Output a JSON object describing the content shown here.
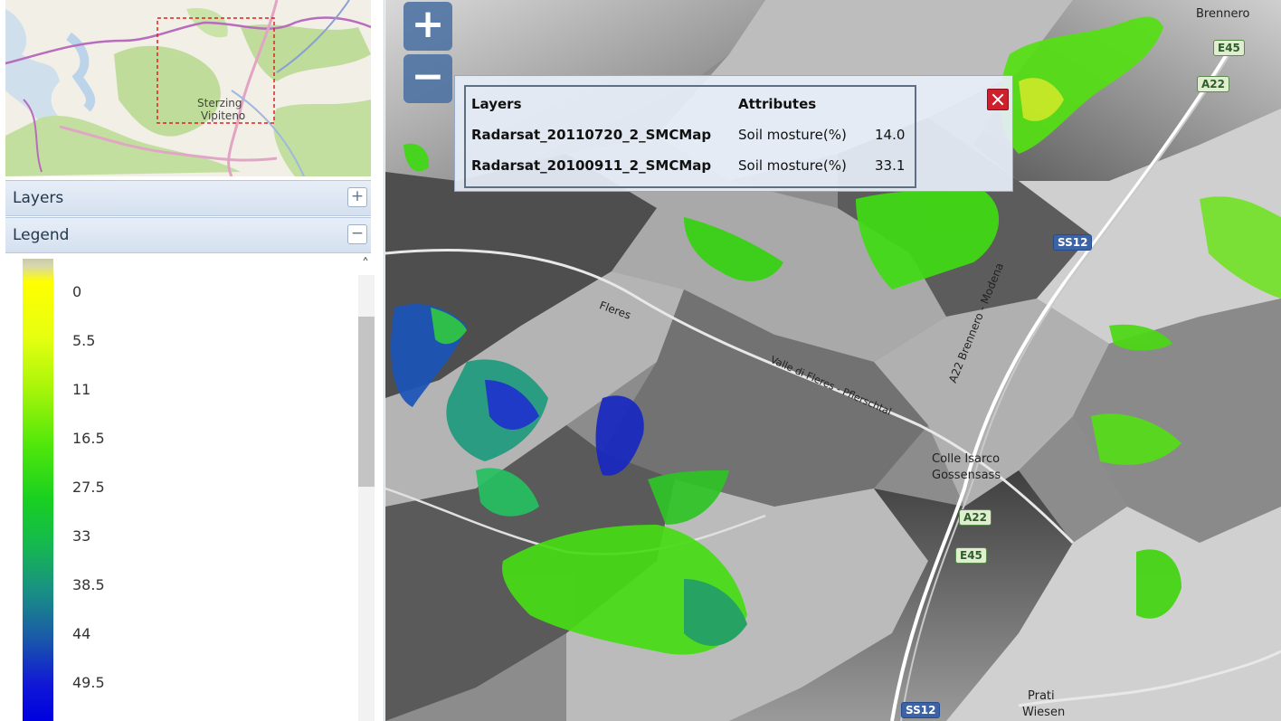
{
  "overview": {
    "place_label_1": "Sterzing",
    "place_label_2": "Vipiteno"
  },
  "panels": {
    "layers_title": "Layers",
    "legend_title": "Legend",
    "expand_symbol": "+",
    "collapse_symbol": "−"
  },
  "legend": {
    "labels": [
      "0",
      "5.5",
      "11",
      "16.5",
      "27.5",
      "33",
      "38.5",
      "44",
      "49.5"
    ],
    "scroll_up_symbol": "˄"
  },
  "map": {
    "zoom_in": "+",
    "zoom_out": "−",
    "labels": {
      "brennero": "Brennero",
      "fleres": "Fleres",
      "valle_fleres": "Valle di Fleres - Pflerschtal",
      "colle_isarco": "Colle Isarco",
      "gossensass": "Gossensass",
      "a22_road": "A22 Brennero - Modena",
      "prati": "Prati",
      "wiesen": "Wiesen"
    },
    "shields": {
      "e45_top": "E45",
      "a22_top": "A22",
      "ss12_mid": "SS12",
      "a22_mid": "A22",
      "e45_mid": "E45",
      "ss12_bottom": "SS12"
    },
    "colors": {
      "accent": "#466ea0",
      "moisture_dry": "#ffff00",
      "moisture_mid": "#32d200",
      "moisture_wet": "#0000e0"
    }
  },
  "popup": {
    "col_layers": "Layers",
    "col_attributes": "Attributes",
    "rows": [
      {
        "layer": "Radarsat_20110720_2_SMCMap",
        "attribute": "Soil mosture(%)",
        "value": "14.0"
      },
      {
        "layer": "Radarsat_20100911_2_SMCMap",
        "attribute": "Soil mosture(%)",
        "value": "33.1"
      }
    ],
    "close_icon": "close-icon"
  }
}
